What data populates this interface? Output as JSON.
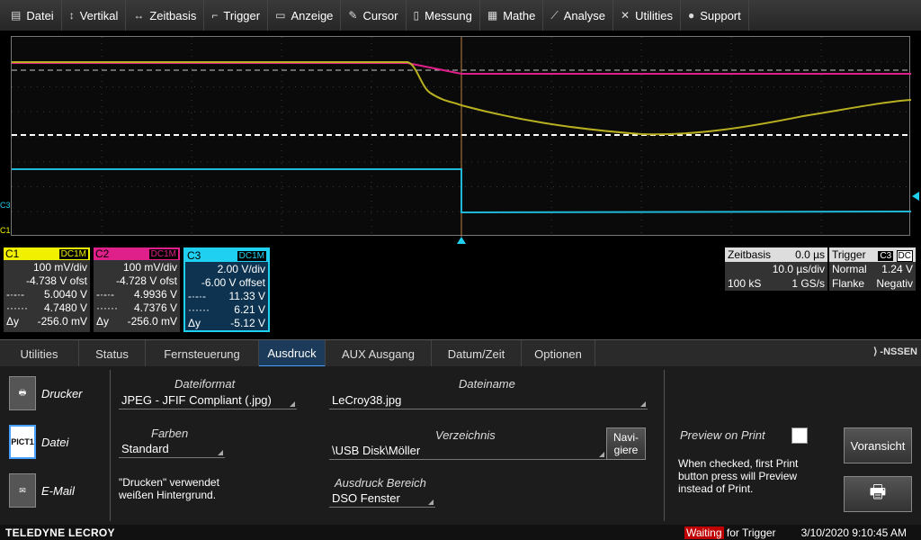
{
  "menu": [
    {
      "label": "Datei",
      "icon": "file-icon"
    },
    {
      "label": "Vertikal",
      "icon": "updown-arrow-icon"
    },
    {
      "label": "Zeitbasis",
      "icon": "leftright-arrow-icon"
    },
    {
      "label": "Trigger",
      "icon": "trigger-icon"
    },
    {
      "label": "Anzeige",
      "icon": "display-icon"
    },
    {
      "label": "Cursor",
      "icon": "cursor-icon"
    },
    {
      "label": "Messung",
      "icon": "measure-icon"
    },
    {
      "label": "Mathe",
      "icon": "math-icon"
    },
    {
      "label": "Analyse",
      "icon": "analyse-icon"
    },
    {
      "label": "Utilities",
      "icon": "tools-icon"
    },
    {
      "label": "Support",
      "icon": "info-icon"
    }
  ],
  "markers": {
    "c3": "C3",
    "c1": "C1"
  },
  "channels": [
    {
      "name": "C1",
      "coupling": "DC1M",
      "color": "#f0f000",
      "vdiv": "100 mV/div",
      "offset": "-4.738 V ofst",
      "cur1_val": "5.0040 V",
      "cur2_val": "4.7480 V",
      "dy_label": "Δy",
      "dy": "-256.0 mV"
    },
    {
      "name": "C2",
      "coupling": "DC1M",
      "color": "#e0208a",
      "vdiv": "100 mV/div",
      "offset": "-4.728 V ofst",
      "cur1_val": "4.9936 V",
      "cur2_val": "4.7376 V",
      "dy_label": "Δy",
      "dy": "-256.0 mV"
    },
    {
      "name": "C3",
      "coupling": "DC1M",
      "color": "#20d0f0",
      "vdiv": "2.00 V/div",
      "offset": "-6.00 V offset",
      "cur1_val": "11.33 V",
      "cur2_val": "6.21 V",
      "dy_label": "Δy",
      "dy": "-5.12 V"
    }
  ],
  "timebase": {
    "label": "Zeitbasis",
    "delay": "0.0 µs",
    "tdiv": "10.0 µs/div",
    "samples": "100 kS",
    "rate": "1 GS/s"
  },
  "trigger": {
    "label": "Trigger",
    "source": "C3",
    "coupling": "DC",
    "mode": "Normal",
    "level": "1.24 V",
    "type": "Flanke",
    "slope": "Negativ"
  },
  "tabs": [
    "Utilities",
    "Status",
    "Fernsteuerung",
    "Ausdruck",
    "AUX Ausgang",
    "Datum/Zeit",
    "Optionen"
  ],
  "active_tab": "Ausdruck",
  "brand_right": "⟩ -NSSEN",
  "nav": {
    "printer": "Drucker",
    "file": "Datei",
    "email": "E-Mail",
    "file_icon_text": "PICT1"
  },
  "form": {
    "dateiformat_label": "Dateiformat",
    "dateiformat": "JPEG - JFIF Compliant (.jpg)",
    "farben_label": "Farben",
    "farben": "Standard",
    "note": "\"Drucken\" verwendet weißen Hintergrund.",
    "dateiname_label": "Dateiname",
    "dateiname": "LeCroy38.jpg",
    "verzeichnis_label": "Verzeichnis",
    "verzeichnis": "\\USB Disk\\Möller",
    "navigieren": "Navi- giere",
    "bereich_label": "Ausdruck Bereich",
    "bereich": "DSO Fenster",
    "preview_label": "Preview on Print",
    "preview_note": "When checked, first Print button press will Preview instead of Print.",
    "voransicht": "Voransicht"
  },
  "status": {
    "brand": "TELEDYNE LECROY",
    "state": "Waiting",
    "state_rest": " for Trigger",
    "datetime": "3/10/2020 9:10:45 AM"
  }
}
